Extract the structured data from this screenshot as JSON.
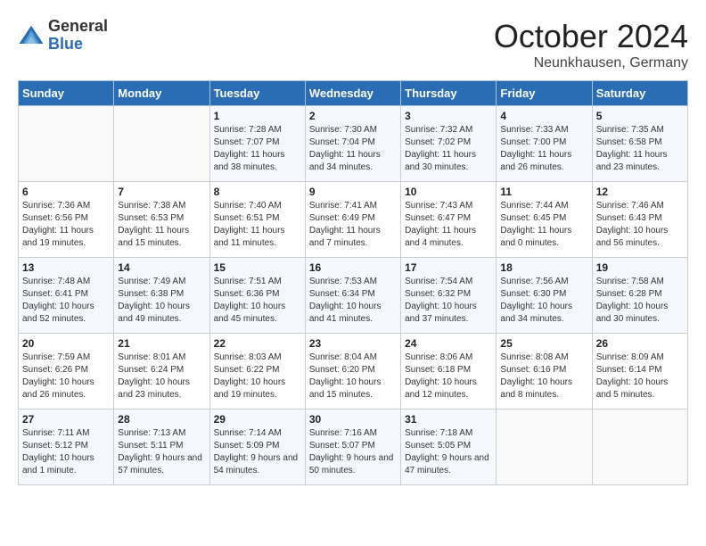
{
  "header": {
    "logo_general": "General",
    "logo_blue": "Blue",
    "month_title": "October 2024",
    "subtitle": "Neunkhausen, Germany"
  },
  "weekdays": [
    "Sunday",
    "Monday",
    "Tuesday",
    "Wednesday",
    "Thursday",
    "Friday",
    "Saturday"
  ],
  "weeks": [
    [
      {
        "day": "",
        "info": ""
      },
      {
        "day": "",
        "info": ""
      },
      {
        "day": "1",
        "info": "Sunrise: 7:28 AM\nSunset: 7:07 PM\nDaylight: 11 hours and 38 minutes."
      },
      {
        "day": "2",
        "info": "Sunrise: 7:30 AM\nSunset: 7:04 PM\nDaylight: 11 hours and 34 minutes."
      },
      {
        "day": "3",
        "info": "Sunrise: 7:32 AM\nSunset: 7:02 PM\nDaylight: 11 hours and 30 minutes."
      },
      {
        "day": "4",
        "info": "Sunrise: 7:33 AM\nSunset: 7:00 PM\nDaylight: 11 hours and 26 minutes."
      },
      {
        "day": "5",
        "info": "Sunrise: 7:35 AM\nSunset: 6:58 PM\nDaylight: 11 hours and 23 minutes."
      }
    ],
    [
      {
        "day": "6",
        "info": "Sunrise: 7:36 AM\nSunset: 6:56 PM\nDaylight: 11 hours and 19 minutes."
      },
      {
        "day": "7",
        "info": "Sunrise: 7:38 AM\nSunset: 6:53 PM\nDaylight: 11 hours and 15 minutes."
      },
      {
        "day": "8",
        "info": "Sunrise: 7:40 AM\nSunset: 6:51 PM\nDaylight: 11 hours and 11 minutes."
      },
      {
        "day": "9",
        "info": "Sunrise: 7:41 AM\nSunset: 6:49 PM\nDaylight: 11 hours and 7 minutes."
      },
      {
        "day": "10",
        "info": "Sunrise: 7:43 AM\nSunset: 6:47 PM\nDaylight: 11 hours and 4 minutes."
      },
      {
        "day": "11",
        "info": "Sunrise: 7:44 AM\nSunset: 6:45 PM\nDaylight: 11 hours and 0 minutes."
      },
      {
        "day": "12",
        "info": "Sunrise: 7:46 AM\nSunset: 6:43 PM\nDaylight: 10 hours and 56 minutes."
      }
    ],
    [
      {
        "day": "13",
        "info": "Sunrise: 7:48 AM\nSunset: 6:41 PM\nDaylight: 10 hours and 52 minutes."
      },
      {
        "day": "14",
        "info": "Sunrise: 7:49 AM\nSunset: 6:38 PM\nDaylight: 10 hours and 49 minutes."
      },
      {
        "day": "15",
        "info": "Sunrise: 7:51 AM\nSunset: 6:36 PM\nDaylight: 10 hours and 45 minutes."
      },
      {
        "day": "16",
        "info": "Sunrise: 7:53 AM\nSunset: 6:34 PM\nDaylight: 10 hours and 41 minutes."
      },
      {
        "day": "17",
        "info": "Sunrise: 7:54 AM\nSunset: 6:32 PM\nDaylight: 10 hours and 37 minutes."
      },
      {
        "day": "18",
        "info": "Sunrise: 7:56 AM\nSunset: 6:30 PM\nDaylight: 10 hours and 34 minutes."
      },
      {
        "day": "19",
        "info": "Sunrise: 7:58 AM\nSunset: 6:28 PM\nDaylight: 10 hours and 30 minutes."
      }
    ],
    [
      {
        "day": "20",
        "info": "Sunrise: 7:59 AM\nSunset: 6:26 PM\nDaylight: 10 hours and 26 minutes."
      },
      {
        "day": "21",
        "info": "Sunrise: 8:01 AM\nSunset: 6:24 PM\nDaylight: 10 hours and 23 minutes."
      },
      {
        "day": "22",
        "info": "Sunrise: 8:03 AM\nSunset: 6:22 PM\nDaylight: 10 hours and 19 minutes."
      },
      {
        "day": "23",
        "info": "Sunrise: 8:04 AM\nSunset: 6:20 PM\nDaylight: 10 hours and 15 minutes."
      },
      {
        "day": "24",
        "info": "Sunrise: 8:06 AM\nSunset: 6:18 PM\nDaylight: 10 hours and 12 minutes."
      },
      {
        "day": "25",
        "info": "Sunrise: 8:08 AM\nSunset: 6:16 PM\nDaylight: 10 hours and 8 minutes."
      },
      {
        "day": "26",
        "info": "Sunrise: 8:09 AM\nSunset: 6:14 PM\nDaylight: 10 hours and 5 minutes."
      }
    ],
    [
      {
        "day": "27",
        "info": "Sunrise: 7:11 AM\nSunset: 5:12 PM\nDaylight: 10 hours and 1 minute."
      },
      {
        "day": "28",
        "info": "Sunrise: 7:13 AM\nSunset: 5:11 PM\nDaylight: 9 hours and 57 minutes."
      },
      {
        "day": "29",
        "info": "Sunrise: 7:14 AM\nSunset: 5:09 PM\nDaylight: 9 hours and 54 minutes."
      },
      {
        "day": "30",
        "info": "Sunrise: 7:16 AM\nSunset: 5:07 PM\nDaylight: 9 hours and 50 minutes."
      },
      {
        "day": "31",
        "info": "Sunrise: 7:18 AM\nSunset: 5:05 PM\nDaylight: 9 hours and 47 minutes."
      },
      {
        "day": "",
        "info": ""
      },
      {
        "day": "",
        "info": ""
      }
    ]
  ]
}
